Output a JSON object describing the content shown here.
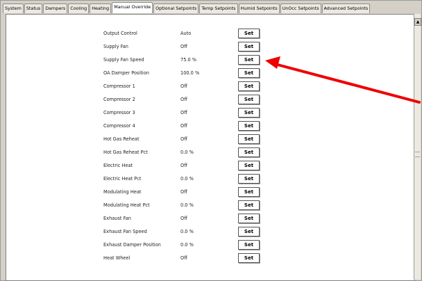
{
  "tabs": [
    {
      "label": "System"
    },
    {
      "label": "Status"
    },
    {
      "label": "Dampers"
    },
    {
      "label": "Cooling"
    },
    {
      "label": "Heating"
    },
    {
      "label": "Manual Override"
    },
    {
      "label": "Optional Setpoints"
    },
    {
      "label": "Temp Setpoints"
    },
    {
      "label": "Humid Setpoints"
    },
    {
      "label": "UnOcc Setpoints"
    },
    {
      "label": "Advanced Setpoints"
    }
  ],
  "active_tab_index": 5,
  "set_label": "Set",
  "rows": [
    {
      "label": "Output Control",
      "value": "Auto"
    },
    {
      "label": "Supply Fan",
      "value": "Off"
    },
    {
      "label": "Supply Fan Speed",
      "value": "75.0 %"
    },
    {
      "label": "OA Damper Position",
      "value": "100.0 %"
    },
    {
      "label": "Compressor 1",
      "value": "Off"
    },
    {
      "label": "Compressor 2",
      "value": "Off"
    },
    {
      "label": "Compressor 3",
      "value": "Off"
    },
    {
      "label": "Compressor 4",
      "value": "Off"
    },
    {
      "label": "Hot Gas Reheat",
      "value": "Off"
    },
    {
      "label": "Hot Gas Reheat Pct",
      "value": "0.0 %"
    },
    {
      "label": "Electric Heat",
      "value": "Off"
    },
    {
      "label": "Electric Heat Pct",
      "value": "0.0 %"
    },
    {
      "label": "Modulating Heat",
      "value": "Off"
    },
    {
      "label": "Modulating Heat Pct",
      "value": "0.0 %"
    },
    {
      "label": "Exhaust Fan",
      "value": "Off"
    },
    {
      "label": "Exhaust Fan Speed",
      "value": "0.0 %"
    },
    {
      "label": "Exhaust Damper Position",
      "value": "0.0 %"
    },
    {
      "label": "Heat Wheel",
      "value": "Off"
    }
  ],
  "scroll_up_glyph": "▲",
  "colors": {
    "annotation_arrow": "#ee0000",
    "tab_bg": "#ece9e1",
    "window_bg": "#d4d0c8"
  }
}
